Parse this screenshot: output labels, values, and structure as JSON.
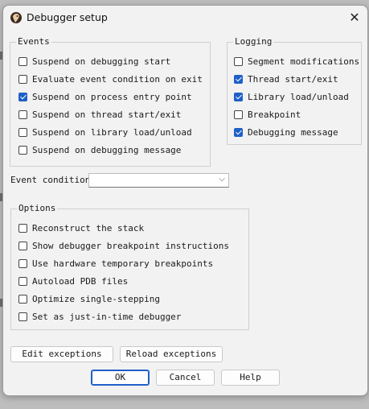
{
  "window": {
    "title": "Debugger setup"
  },
  "events": {
    "title": "Events",
    "items": [
      {
        "label": "Suspend on debugging start",
        "checked": false
      },
      {
        "label": "Evaluate event condition on exit",
        "checked": false
      },
      {
        "label": "Suspend on process entry point",
        "checked": true
      },
      {
        "label": "Suspend on thread start/exit",
        "checked": false
      },
      {
        "label": "Suspend on library load/unload",
        "checked": false
      },
      {
        "label": "Suspend on debugging message",
        "checked": false
      }
    ]
  },
  "logging": {
    "title": "Logging",
    "items": [
      {
        "label": "Segment modifications",
        "checked": false
      },
      {
        "label": "Thread start/exit",
        "checked": true
      },
      {
        "label": "Library load/unload",
        "checked": true
      },
      {
        "label": "Breakpoint",
        "checked": false
      },
      {
        "label": "Debugging message",
        "checked": true
      }
    ]
  },
  "event_condition": {
    "label": "Event condition",
    "value": ""
  },
  "options": {
    "title": "Options",
    "items": [
      {
        "label": "Reconstruct the stack",
        "checked": false
      },
      {
        "label": "Show debugger breakpoint instructions",
        "checked": false
      },
      {
        "label": "Use hardware temporary breakpoints",
        "checked": false
      },
      {
        "label": "Autoload PDB files",
        "checked": false
      },
      {
        "label": "Optimize single-stepping",
        "checked": false
      },
      {
        "label": "Set as just-in-time debugger",
        "checked": false
      }
    ]
  },
  "buttons": {
    "edit_exceptions": "Edit exceptions",
    "reload_exceptions": "Reload exceptions",
    "ok": "OK",
    "cancel": "Cancel",
    "help": "Help"
  }
}
